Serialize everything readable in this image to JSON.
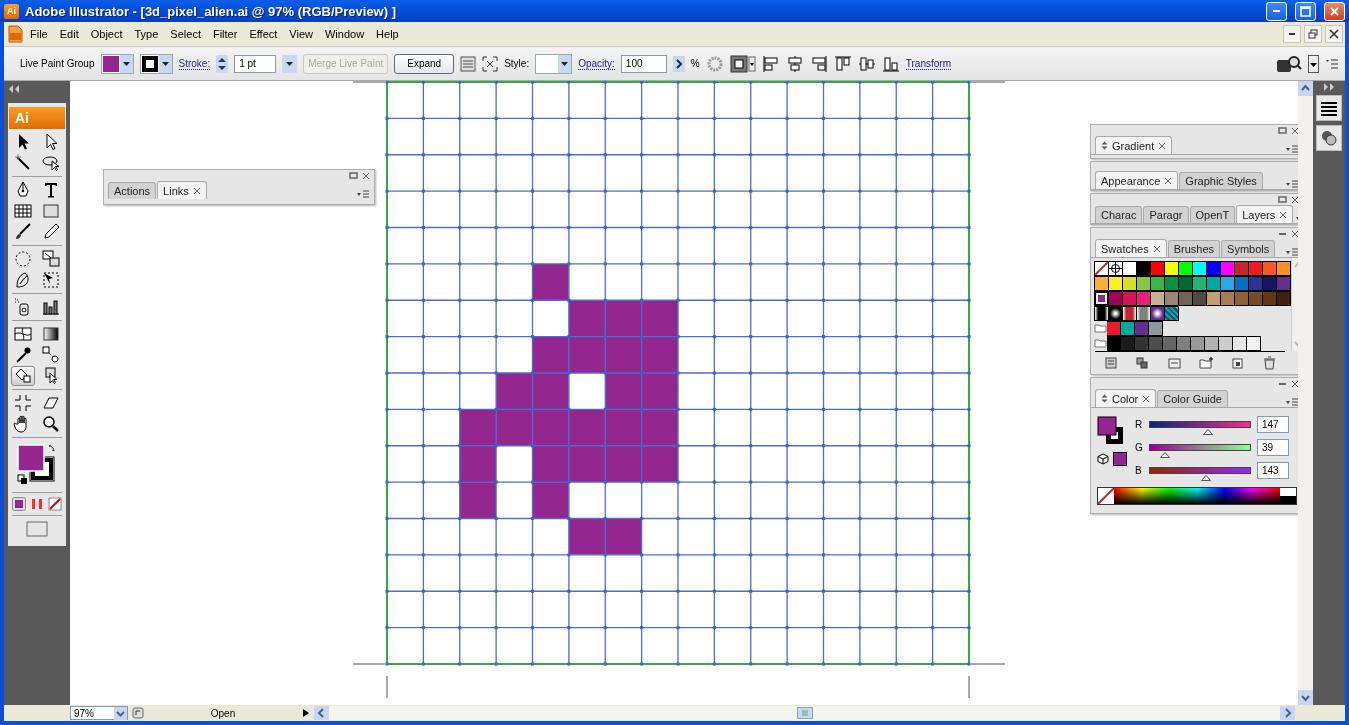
{
  "window": {
    "app_badge": "Ai",
    "title": "Adobe Illustrator - [3d_pixel_alien.ai @ 97% (RGB/Preview) ]"
  },
  "menu": [
    "File",
    "Edit",
    "Object",
    "Type",
    "Select",
    "Filter",
    "Effect",
    "View",
    "Window",
    "Help"
  ],
  "control_bar": {
    "selection_label": "Live Paint Group",
    "stroke_label": "Stroke:",
    "stroke_value": "1 pt",
    "merge_button": {
      "label": "Merge Live Paint",
      "disabled": true
    },
    "expand_button": {
      "label": "Expand",
      "disabled": false
    },
    "style_label": "Style:",
    "opacity_label": "Opacity:",
    "opacity_value": "100",
    "percent": "%",
    "transform_link": "Transform"
  },
  "tools_panel": {
    "logo": "Ai",
    "tool_groups": [
      [
        {
          "kind": "selection",
          "selected": false
        },
        {
          "kind": "direct-selection",
          "selected": false
        },
        {
          "kind": "magic-wand",
          "selected": false
        },
        {
          "kind": "lasso",
          "selected": false
        }
      ],
      [
        {
          "kind": "pen",
          "selected": false
        },
        {
          "kind": "type",
          "selected": false
        },
        {
          "kind": "grid",
          "selected": false
        },
        {
          "kind": "rectangle",
          "selected": false
        },
        {
          "kind": "paintbrush",
          "selected": false
        },
        {
          "kind": "pencil",
          "selected": false
        }
      ],
      [
        {
          "kind": "rotate",
          "selected": false
        },
        {
          "kind": "scale",
          "selected": false
        },
        {
          "kind": "warp",
          "selected": false
        },
        {
          "kind": "free-transform",
          "selected": false
        }
      ],
      [
        {
          "kind": "symbol-sprayer",
          "selected": false
        },
        {
          "kind": "column-graph",
          "selected": false
        }
      ],
      [
        {
          "kind": "mesh",
          "selected": false
        },
        {
          "kind": "gradient",
          "selected": false
        },
        {
          "kind": "eyedropper",
          "selected": false
        },
        {
          "kind": "blend",
          "selected": false
        },
        {
          "kind": "live-paint-bucket",
          "selected": true
        },
        {
          "kind": "live-paint-selection",
          "selected": false
        }
      ],
      [
        {
          "kind": "slice",
          "selected": false
        },
        {
          "kind": "eraser",
          "selected": false
        },
        {
          "kind": "hand",
          "selected": false
        },
        {
          "kind": "zoom",
          "selected": false
        }
      ]
    ]
  },
  "floating_panel": {
    "tabs": [
      {
        "label": "Actions",
        "selected": false
      },
      {
        "label": "Links",
        "selected": true
      }
    ]
  },
  "artboard": {
    "rows": [
      [
        false,
        false,
        false,
        false,
        false,
        false,
        false,
        false,
        false,
        false,
        false,
        false,
        false,
        false,
        false,
        false
      ],
      [
        false,
        false,
        false,
        false,
        false,
        false,
        false,
        false,
        false,
        false,
        false,
        false,
        false,
        false,
        false,
        false
      ],
      [
        false,
        false,
        false,
        false,
        false,
        false,
        false,
        false,
        false,
        false,
        false,
        false,
        false,
        false,
        false,
        false
      ],
      [
        false,
        false,
        false,
        false,
        false,
        false,
        false,
        false,
        false,
        false,
        false,
        false,
        false,
        false,
        false,
        false
      ],
      [
        false,
        false,
        false,
        false,
        false,
        false,
        false,
        false,
        false,
        false,
        false,
        false,
        false,
        false,
        false,
        false
      ],
      [
        false,
        false,
        false,
        false,
        true,
        false,
        false,
        false,
        false,
        false,
        false,
        false,
        false,
        false,
        false,
        false
      ],
      [
        false,
        false,
        false,
        false,
        false,
        true,
        true,
        true,
        false,
        false,
        false,
        false,
        false,
        false,
        false,
        false
      ],
      [
        false,
        false,
        false,
        false,
        true,
        true,
        true,
        true,
        false,
        false,
        false,
        false,
        false,
        false,
        false,
        false
      ],
      [
        false,
        false,
        false,
        true,
        true,
        false,
        true,
        true,
        false,
        false,
        false,
        false,
        false,
        false,
        false,
        false
      ],
      [
        false,
        false,
        true,
        true,
        true,
        true,
        true,
        true,
        false,
        false,
        false,
        false,
        false,
        false,
        false,
        false
      ],
      [
        false,
        false,
        true,
        false,
        true,
        true,
        true,
        true,
        false,
        false,
        false,
        false,
        false,
        false,
        false,
        false
      ],
      [
        false,
        false,
        true,
        false,
        true,
        false,
        false,
        false,
        false,
        false,
        false,
        false,
        false,
        false,
        false,
        false
      ],
      [
        false,
        false,
        false,
        false,
        false,
        true,
        true,
        false,
        false,
        false,
        false,
        false,
        false,
        false,
        false,
        false
      ],
      [
        false,
        false,
        false,
        false,
        false,
        false,
        false,
        false,
        false,
        false,
        false,
        false,
        false,
        false,
        false,
        false
      ],
      [
        false,
        false,
        false,
        false,
        false,
        false,
        false,
        false,
        false,
        false,
        false,
        false,
        false,
        false,
        false,
        false
      ],
      [
        false,
        false,
        false,
        false,
        false,
        false,
        false,
        false,
        false,
        false,
        false,
        false,
        false,
        false,
        false,
        false
      ]
    ]
  },
  "panel_groups": [
    {
      "tabs": [
        {
          "label": "Gradient",
          "selected": true
        }
      ]
    },
    {
      "tabs": [
        {
          "label": "Appearance",
          "selected": true
        },
        {
          "label": "Graphic Styles",
          "selected": false
        }
      ]
    },
    {
      "tabs": [
        {
          "label": "Charac",
          "selected": false
        },
        {
          "label": "Paragr",
          "selected": false
        },
        {
          "label": "OpenT",
          "selected": false
        },
        {
          "label": "Layers",
          "selected": true
        }
      ]
    }
  ],
  "swatches_panel": {
    "tabs": [
      {
        "label": "Swatches",
        "selected": true
      },
      {
        "label": "Brushes",
        "selected": false
      },
      {
        "label": "Symbols",
        "selected": false
      }
    ],
    "rows": [
      [
        {
          "kind": "none",
          "selected": false
        },
        {
          "kind": "registration",
          "selected": false
        },
        {
          "kind": "color",
          "color": "#ffffff",
          "selected": false
        },
        {
          "kind": "color",
          "color": "#000000",
          "selected": false
        },
        {
          "kind": "color",
          "color": "#ff0000",
          "selected": false
        },
        {
          "kind": "color",
          "color": "#ffff00",
          "selected": false
        },
        {
          "kind": "color",
          "color": "#00ff00",
          "selected": false
        },
        {
          "kind": "color",
          "color": "#00ffff",
          "selected": false
        },
        {
          "kind": "color",
          "color": "#0000ff",
          "selected": false
        },
        {
          "kind": "color",
          "color": "#ff00ff",
          "selected": false
        },
        {
          "kind": "color",
          "color": "#c1272d",
          "selected": false
        },
        {
          "kind": "color",
          "color": "#ed1c24",
          "selected": false
        },
        {
          "kind": "color",
          "color": "#f15a24",
          "selected": false
        },
        {
          "kind": "color",
          "color": "#f7931e",
          "selected": false
        }
      ],
      [
        {
          "kind": "color",
          "color": "#fbb03b",
          "selected": false
        },
        {
          "kind": "color",
          "color": "#fcee21",
          "selected": false
        },
        {
          "kind": "color",
          "color": "#d9e021",
          "selected": false
        },
        {
          "kind": "color",
          "color": "#8cc63f",
          "selected": false
        },
        {
          "kind": "color",
          "color": "#39b54a",
          "selected": false
        },
        {
          "kind": "color",
          "color": "#009245",
          "selected": false
        },
        {
          "kind": "color",
          "color": "#006837",
          "selected": false
        },
        {
          "kind": "color",
          "color": "#22b573",
          "selected": false
        },
        {
          "kind": "color",
          "color": "#00a99d",
          "selected": false
        },
        {
          "kind": "color",
          "color": "#29abe2",
          "selected": false
        },
        {
          "kind": "color",
          "color": "#0071bc",
          "selected": false
        },
        {
          "kind": "color",
          "color": "#2e3192",
          "selected": false
        },
        {
          "kind": "color",
          "color": "#1b1464",
          "selected": false
        },
        {
          "kind": "color",
          "color": "#662d91",
          "selected": false
        }
      ],
      [
        {
          "kind": "color",
          "color": "#93278f",
          "selected": true
        },
        {
          "kind": "color",
          "color": "#9e005d",
          "selected": false
        },
        {
          "kind": "color",
          "color": "#d4145a",
          "selected": false
        },
        {
          "kind": "color",
          "color": "#ed1e79",
          "selected": false
        },
        {
          "kind": "color",
          "color": "#c7b299",
          "selected": false
        },
        {
          "kind": "color",
          "color": "#998675",
          "selected": false
        },
        {
          "kind": "color",
          "color": "#736357",
          "selected": false
        },
        {
          "kind": "color",
          "color": "#534741",
          "selected": false
        },
        {
          "kind": "color",
          "color": "#c69c6d",
          "selected": false
        },
        {
          "kind": "color",
          "color": "#a67c52",
          "selected": false
        },
        {
          "kind": "color",
          "color": "#8c6239",
          "selected": false
        },
        {
          "kind": "color",
          "color": "#754c24",
          "selected": false
        },
        {
          "kind": "color",
          "color": "#603813",
          "selected": false
        },
        {
          "kind": "color",
          "color": "#42210b",
          "selected": false
        }
      ],
      [
        {
          "kind": "gradient",
          "color": "#000000",
          "selected": false
        },
        {
          "kind": "radial",
          "color": "#000000",
          "selected": false
        },
        {
          "kind": "gradient",
          "color": "#c1272d",
          "selected": false
        },
        {
          "kind": "gradient",
          "color": "#808080",
          "selected": false
        },
        {
          "kind": "radial",
          "color": "#662d91",
          "selected": false
        },
        {
          "kind": "pattern",
          "color": "#00a99d",
          "selected": false
        }
      ],
      [
        {
          "kind": "folder",
          "selected": false
        },
        {
          "kind": "color",
          "color": "#ed1c24",
          "selected": false
        },
        {
          "kind": "color",
          "color": "#00a99d",
          "selected": false
        },
        {
          "kind": "color",
          "color": "#662d91",
          "selected": false
        },
        {
          "kind": "color",
          "color": "#8e979b",
          "selected": false
        }
      ],
      [
        {
          "kind": "folder",
          "selected": false
        },
        {
          "kind": "color",
          "color": "#000000",
          "selected": false
        },
        {
          "kind": "color",
          "color": "#1a1a1a",
          "selected": false
        },
        {
          "kind": "color",
          "color": "#333333",
          "selected": false
        },
        {
          "kind": "color",
          "color": "#4d4d4d",
          "selected": false
        },
        {
          "kind": "color",
          "color": "#666666",
          "selected": false
        },
        {
          "kind": "color",
          "color": "#808080",
          "selected": false
        },
        {
          "kind": "color",
          "color": "#999999",
          "selected": false
        },
        {
          "kind": "color",
          "color": "#b3b3b3",
          "selected": false
        },
        {
          "kind": "color",
          "color": "#cccccc",
          "selected": false
        },
        {
          "kind": "color",
          "color": "#e6e6e6",
          "selected": false
        },
        {
          "kind": "color",
          "color": "#f2f2f2",
          "selected": false
        }
      ]
    ]
  },
  "color_panel": {
    "tabs": [
      {
        "label": "Color",
        "selected": true
      },
      {
        "label": "Color Guide",
        "selected": false
      }
    ],
    "channels": [
      {
        "name": "R",
        "level": 0.576,
        "reading": "147"
      },
      {
        "name": "G",
        "level": 0.153,
        "reading": "39"
      },
      {
        "name": "B",
        "level": 0.561,
        "reading": "143"
      }
    ]
  },
  "status_bar": {
    "zoom": "97%",
    "status": "Open"
  }
}
